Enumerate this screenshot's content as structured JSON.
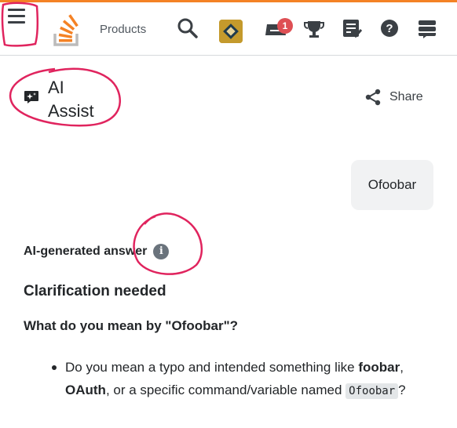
{
  "topbar": {
    "products_label": "Products",
    "inbox_badge": "1",
    "accent_color": "#f48225",
    "icons": [
      "hamburger-icon",
      "stack-overflow-logo",
      "search-icon",
      "user-avatar",
      "inbox-icon",
      "trophy-icon",
      "review-icon",
      "help-icon",
      "site-switcher-icon"
    ]
  },
  "page": {
    "title": "AI Assist",
    "share_label": "Share"
  },
  "chat": {
    "user_message": "Ofoobar",
    "answer_label": "AI-generated answer",
    "heading": "Clarification needed",
    "question": "What do you mean by \"Ofoobar\"?",
    "bullet": {
      "prefix": "Do you mean a typo and intended something like",
      "term1": "foobar",
      "sep1": ",",
      "term2": "OAuth",
      "middle": ", or a specific command/variable named",
      "code": "Ofoobar",
      "suffix": "?"
    }
  },
  "annotation_color": "#e0245e"
}
